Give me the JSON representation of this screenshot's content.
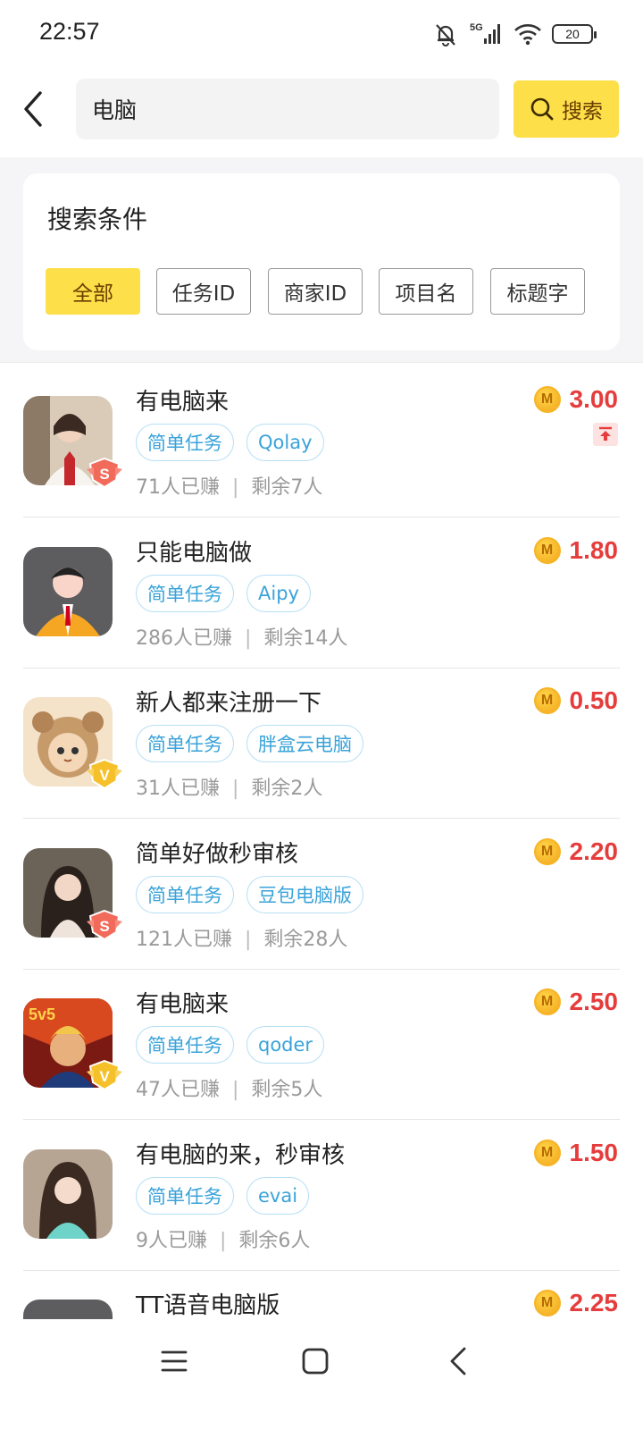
{
  "status": {
    "time": "22:57",
    "network": "5G",
    "battery": "20"
  },
  "header": {
    "search_value": "电脑",
    "search_button": "搜索"
  },
  "filter": {
    "title": "搜索条件",
    "chips": [
      "全部",
      "任务ID",
      "商家ID",
      "项目名",
      "标题字"
    ],
    "active_index": 0
  },
  "tasks": [
    {
      "title": "有电脑来",
      "tags": [
        "简单任务",
        "Qolay"
      ],
      "earned": "71人已赚",
      "remaining": "剩余7人",
      "price": "3.00",
      "badge": "S",
      "pinned": true
    },
    {
      "title": "只能电脑做",
      "tags": [
        "简单任务",
        "Aipy"
      ],
      "earned": "286人已赚",
      "remaining": "剩余14人",
      "price": "1.80",
      "badge": "",
      "pinned": false
    },
    {
      "title": "新人都来注册一下",
      "tags": [
        "简单任务",
        "胖盒云电脑"
      ],
      "earned": "31人已赚",
      "remaining": "剩余2人",
      "price": "0.50",
      "badge": "V",
      "pinned": false
    },
    {
      "title": "简单好做秒审核",
      "tags": [
        "简单任务",
        "豆包电脑版"
      ],
      "earned": "121人已赚",
      "remaining": "剩余28人",
      "price": "2.20",
      "badge": "S",
      "pinned": false
    },
    {
      "title": "有电脑来",
      "tags": [
        "简单任务",
        "qoder"
      ],
      "earned": "47人已赚",
      "remaining": "剩余5人",
      "price": "2.50",
      "badge": "V",
      "pinned": false
    },
    {
      "title": "有电脑的来，秒审核",
      "tags": [
        "简单任务",
        "evai"
      ],
      "earned": "9人已赚",
      "remaining": "剩余6人",
      "price": "1.50",
      "badge": "",
      "pinned": false
    },
    {
      "title": "TT语音电脑版",
      "tags": [],
      "earned": "",
      "remaining": "",
      "price": "2.25",
      "badge": "",
      "pinned": false
    }
  ],
  "coin_letter": "M",
  "colors": {
    "accent": "#fddf4a",
    "price": "#e63c3c",
    "tag": "#3aa3d9"
  }
}
